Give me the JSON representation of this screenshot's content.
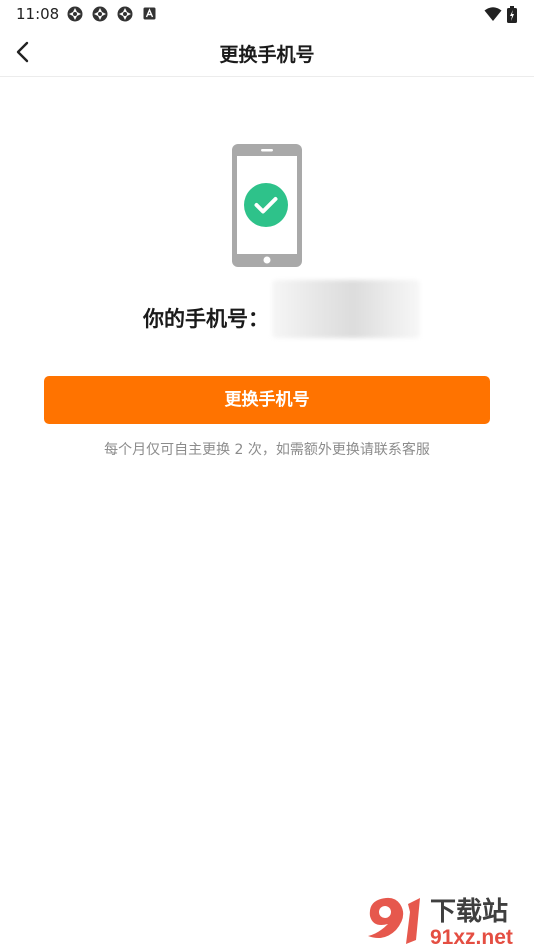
{
  "status_bar": {
    "time": "11:08",
    "icons": [
      "app-notification-icon",
      "app-notification-icon",
      "app-notification-icon",
      "accessibility-icon",
      "wifi-icon",
      "battery-charging-icon"
    ]
  },
  "nav": {
    "title": "更换手机号",
    "back_icon": "chevron-left-icon"
  },
  "main": {
    "illustration_icon": "phone-verified-icon",
    "phone_label": "你的手机号：",
    "phone_value_masked": true,
    "change_button_label": "更换手机号",
    "hint": "每个月仅可自主更换 2 次，如需额外更换请联系客服"
  },
  "watermark": {
    "top_text": "下载站",
    "bottom_text": "91xz.net"
  },
  "colors": {
    "accent": "#ff7300",
    "success": "#2ec28a",
    "phone_gray": "#a9a9a9",
    "hint_gray": "#8c8c8c",
    "watermark_red": "#e23b2e"
  }
}
